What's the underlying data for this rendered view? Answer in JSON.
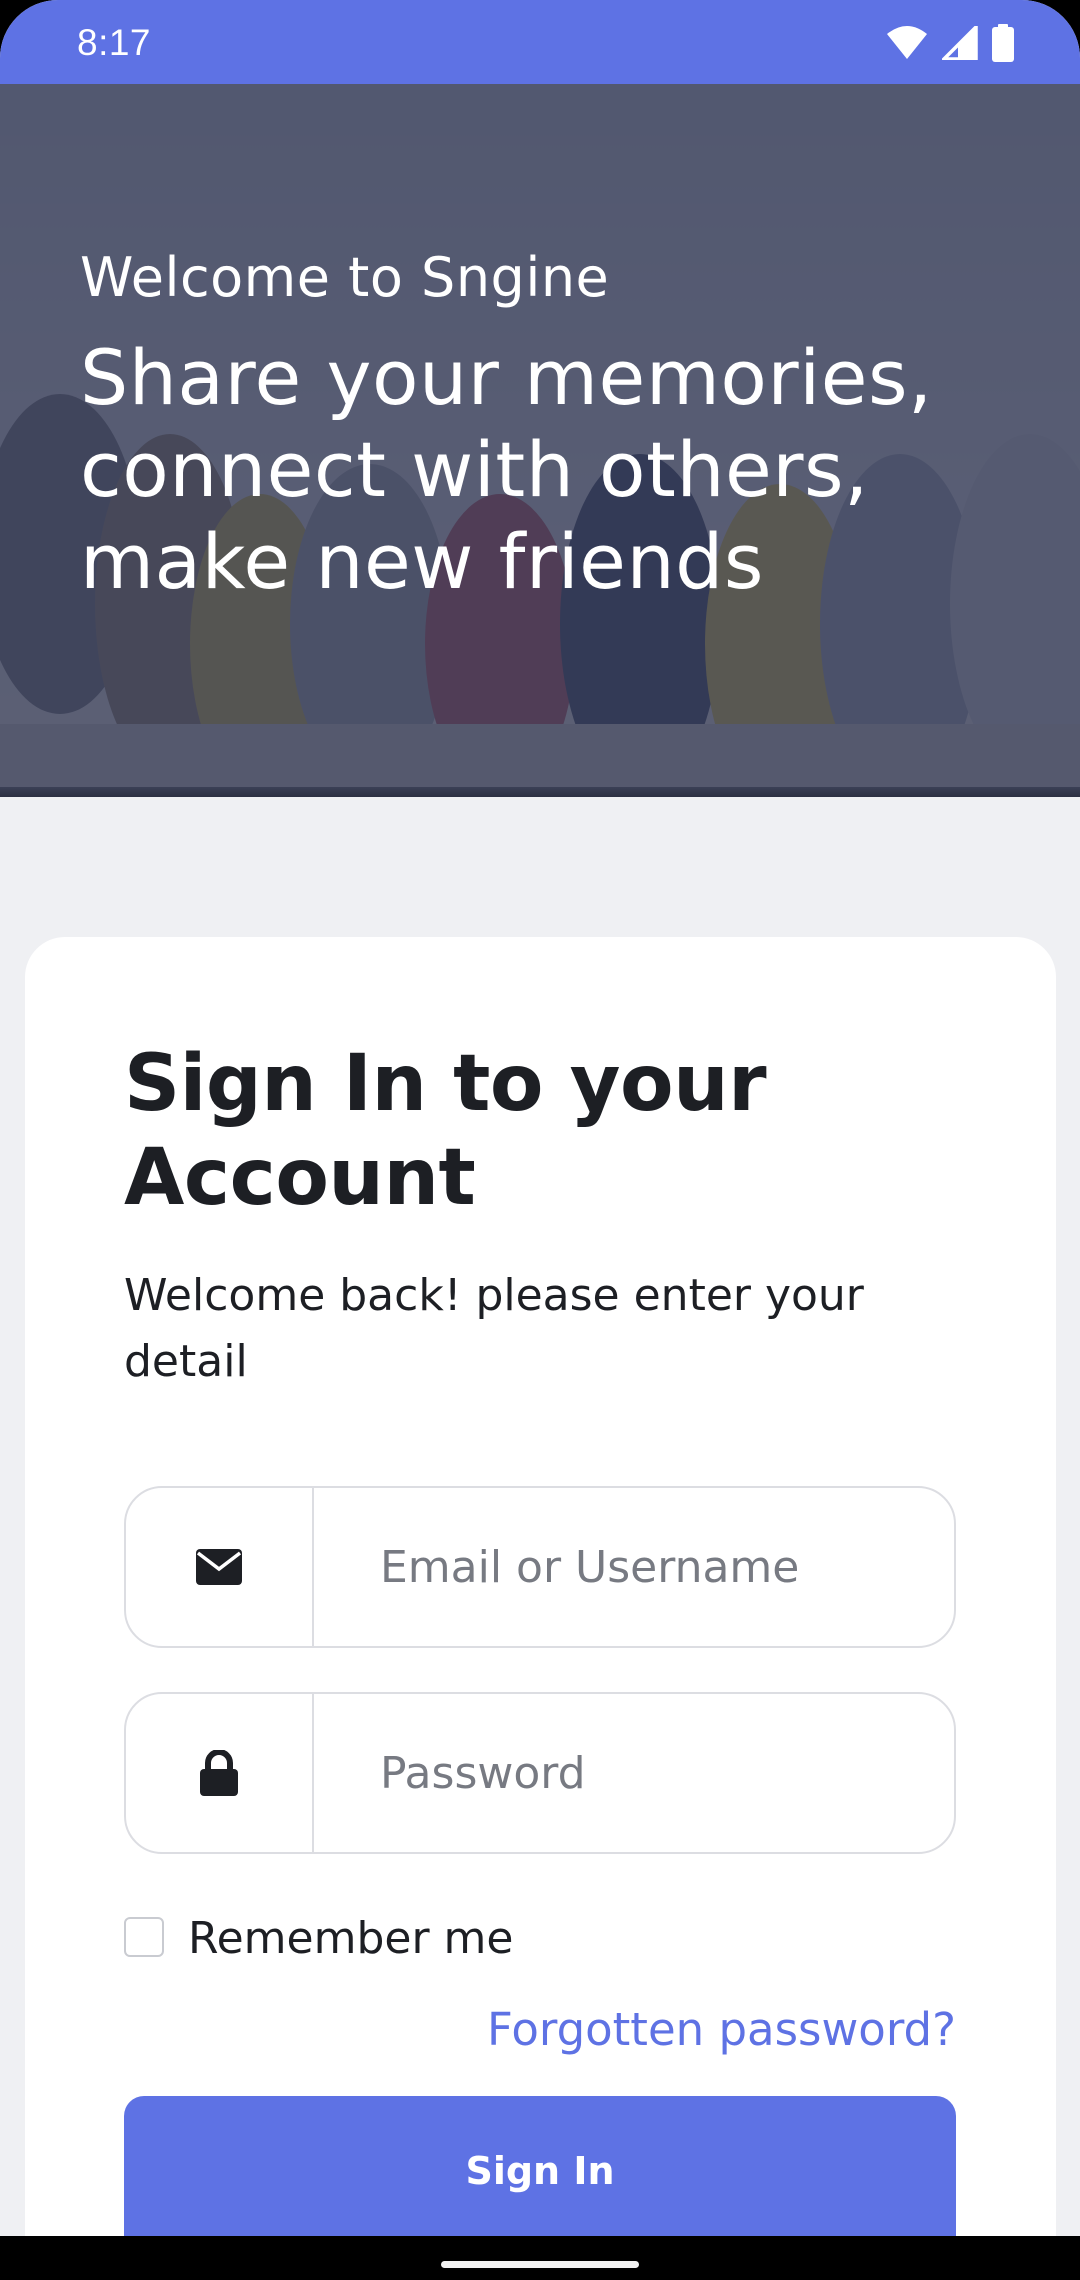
{
  "status_bar": {
    "time": "8:17",
    "color": "#5e72e4"
  },
  "hero": {
    "welcome": "Welcome to Sngine",
    "tagline": "Share your memories, connect with others, make new friends"
  },
  "card": {
    "title": "Sign In to your Account",
    "subtitle": "Welcome back! please enter your detail",
    "email_placeholder": "Email or Username",
    "password_placeholder": "Password",
    "remember_label": "Remember me",
    "remember_checked": false,
    "forgot_label": "Forgotten password?",
    "signin_label": "Sign In"
  },
  "icons": {
    "email": "envelope-icon",
    "password": "lock-icon",
    "wifi": "wifi-icon",
    "signal": "signal-icon",
    "battery": "battery-icon"
  },
  "colors": {
    "accent": "#5e72e4",
    "background": "#eff0f3",
    "text": "#1d1f24"
  }
}
